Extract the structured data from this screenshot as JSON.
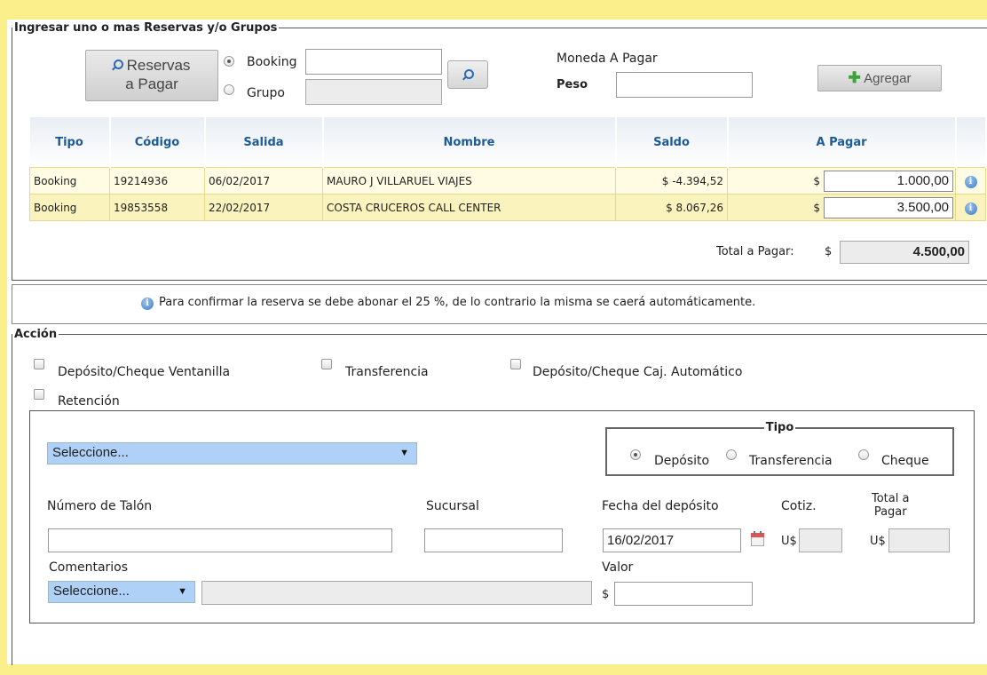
{
  "reservas": {
    "legend": "Ingresar uno o mas Reservas y/o Grupos",
    "btn_line1": "Reservas",
    "btn_line2": "a Pagar",
    "radio_booking": "Booking",
    "radio_grupo": "Grupo",
    "booking_value": "",
    "grupo_value": "",
    "moneda_label": "Moneda A Pagar",
    "peso_label": "Peso",
    "peso_value": "",
    "agregar_label": "Agregar"
  },
  "table": {
    "headers": [
      "Tipo",
      "Código",
      "Salida",
      "Nombre",
      "Saldo",
      "A Pagar"
    ],
    "rows": [
      {
        "tipo": "Booking",
        "codigo": "19214936",
        "salida": "06/02/2017",
        "nombre": "MAURO J VILLARUEL VIAJES",
        "saldo": "$ -4.394,52",
        "currency": "$",
        "pagar": "1.000,00"
      },
      {
        "tipo": "Booking",
        "codigo": "19853558",
        "salida": "22/02/2017",
        "nombre": "COSTA CRUCEROS CALL CENTER",
        "saldo": "$ 8.067,26",
        "currency": "$",
        "pagar": "3.500,00"
      }
    ],
    "total_label": "Total a Pagar:",
    "total_currency": "$",
    "total_value": "4.500,00"
  },
  "notice": "Para confirmar la reserva se debe abonar el 25 %, de lo contrario la misma se caerá automáticamente.",
  "accion": {
    "legend": "Acción",
    "opt1": "Depósito/Cheque Ventanilla",
    "opt2": "Transferencia",
    "opt3": "Depósito/Cheque Caj. Automático",
    "opt4": "Retención",
    "select_main": "Seleccione...",
    "tipo_legend": "Tipo",
    "tipo_deposito": "Depósito",
    "tipo_transferencia": "Transferencia",
    "tipo_cheque": "Cheque",
    "talon_label": "Número de Talón",
    "talon_value": "",
    "sucursal_label": "Sucursal",
    "sucursal_value": "",
    "fecha_label": "Fecha del depósito",
    "fecha_value": "16/02/2017",
    "cotiz_label": "Cotiz.",
    "cotiz_currency": "U$",
    "total_label_1": "Total a",
    "total_label_2": "Pagar",
    "total_currency": "U$",
    "comentarios_label": "Comentarios",
    "comentarios_select": "Seleccione...",
    "valor_label": "Valor",
    "valor_currency": "$",
    "valor_value": ""
  }
}
